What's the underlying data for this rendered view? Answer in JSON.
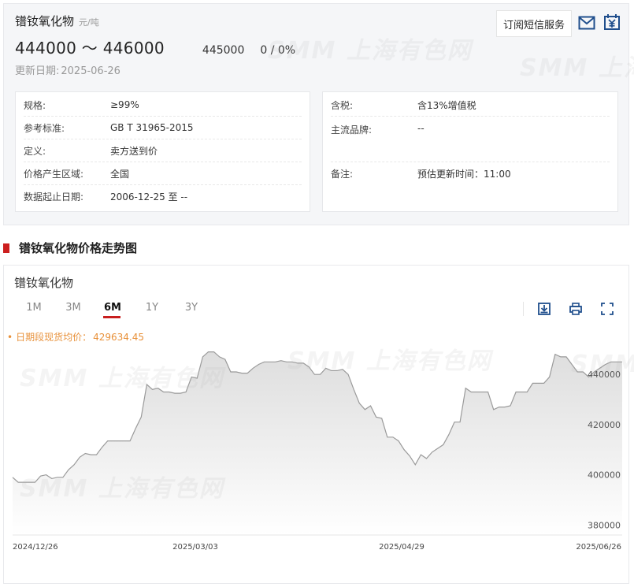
{
  "header": {
    "product_name": "镨钕氧化物",
    "unit": "元/吨",
    "price_range": "444000 ～ 446000",
    "avg_price": "445000",
    "change": "0 / 0%",
    "update_label": "更新日期:",
    "update_date": "2025-06-26",
    "subscribe_label": "订阅短信服务"
  },
  "info_left": [
    {
      "k": "规格:",
      "v": "≥99%"
    },
    {
      "k": "参考标准:",
      "v": "GB T 31965-2015"
    },
    {
      "k": "定义:",
      "v": "卖方送到价"
    },
    {
      "k": "价格产生区域:",
      "v": "全国"
    },
    {
      "k": "数据起止日期:",
      "v": "2006-12-25 至 --"
    }
  ],
  "info_right": [
    {
      "k": "含税:",
      "v": "含13%增值税"
    },
    {
      "k": "主流品牌:",
      "v": "--"
    },
    {
      "k": "备注:",
      "v": "预估更新时间：11:00"
    }
  ],
  "section_title": "镨钕氧化物价格走势图",
  "chart_card": {
    "name": "镨钕氧化物",
    "tabs": [
      "1M",
      "3M",
      "6M",
      "1Y",
      "3Y"
    ],
    "active_tab": "6M",
    "avg_label": "日期段现货均价：",
    "avg_value": "429634.45",
    "watermark": "SMM 上海有色网"
  },
  "colors": {
    "accent": "#c81e1e",
    "avg_note": "#e8913a",
    "line": "#9a9a9a"
  },
  "chart_data": {
    "type": "area",
    "x_tick_labels": [
      "2024/12/26",
      "2025/03/03",
      "2025/04/29",
      "2025/06/26"
    ],
    "y_ticks": [
      380000,
      400000,
      420000,
      440000
    ],
    "ylim": [
      376000,
      452000
    ],
    "grid": false,
    "values": [
      399000,
      397000,
      397000,
      397000,
      397000,
      399500,
      400000,
      398500,
      399000,
      399000,
      402000,
      404000,
      407000,
      408500,
      408000,
      408000,
      411000,
      413500,
      413500,
      413500,
      413500,
      413500,
      418500,
      423000,
      436000,
      434000,
      434500,
      433000,
      433000,
      432500,
      432500,
      433000,
      439000,
      438500,
      447000,
      449000,
      449000,
      447000,
      446000,
      441000,
      441000,
      440500,
      440500,
      442500,
      444000,
      445000,
      445000,
      445000,
      445500,
      445000,
      445000,
      444500,
      444500,
      443000,
      440000,
      440000,
      442500,
      441500,
      441500,
      442000,
      440000,
      434000,
      428500,
      426000,
      427500,
      423000,
      422500,
      415000,
      415000,
      413500,
      410000,
      407500,
      404000,
      408000,
      406500,
      409000,
      410500,
      412000,
      416000,
      421000,
      421000,
      434500,
      433000,
      433000,
      433000,
      433000,
      426000,
      427000,
      427000,
      427500,
      433000,
      433000,
      433000,
      436500,
      436500,
      436500,
      439000,
      448000,
      447000,
      447000,
      444000,
      441000,
      441000,
      439000,
      441000,
      442500,
      444000,
      445000,
      445000,
      445000
    ]
  }
}
